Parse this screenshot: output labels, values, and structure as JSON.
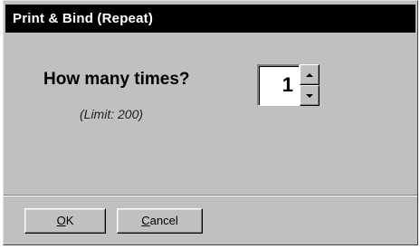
{
  "window": {
    "title": "Print & Bind (Repeat)"
  },
  "prompt": {
    "question": "How many times?",
    "limit_note": "(Limit: 200)"
  },
  "count_field": {
    "value": "1"
  },
  "buttons": {
    "ok": {
      "accel": "O",
      "rest": "K"
    },
    "cancel": {
      "accel": "C",
      "rest": "ancel"
    }
  },
  "icons": {
    "spin_up": "spin-up-arrow-icon",
    "spin_down": "spin-down-arrow-icon"
  },
  "colors": {
    "titlebar_bg": "#000000",
    "titlebar_text": "#ffffff",
    "dialog_bg": "#c0c0c0"
  }
}
